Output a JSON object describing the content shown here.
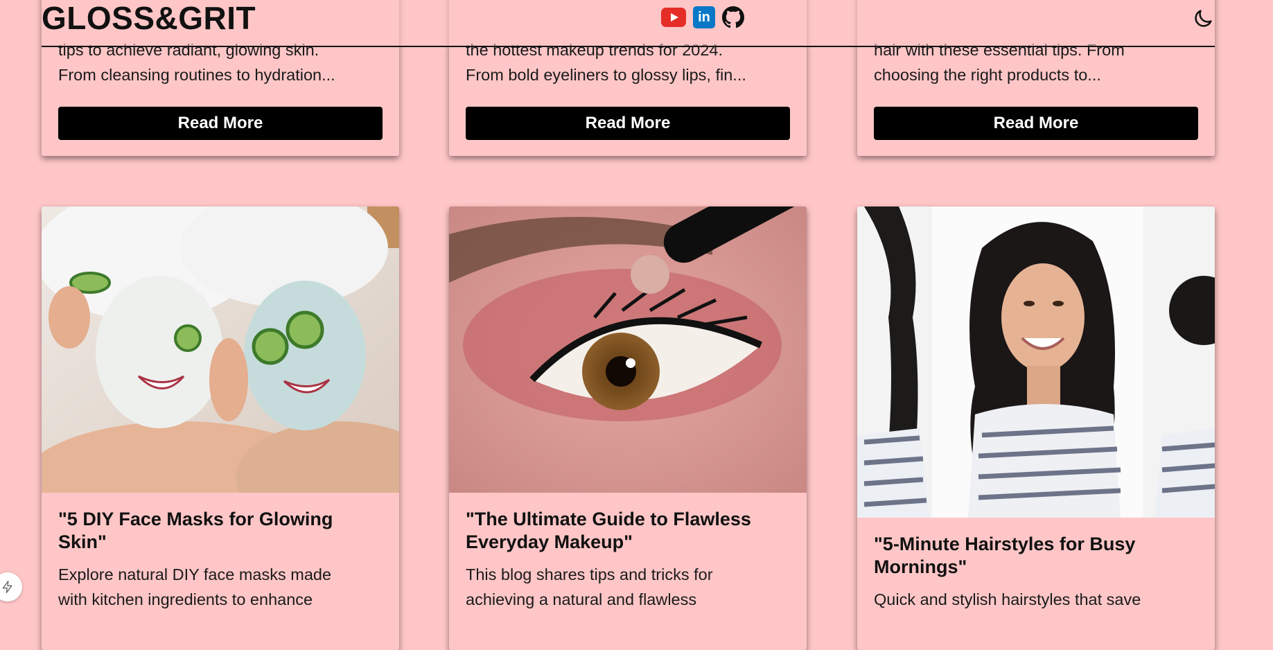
{
  "header": {
    "logo": "GLOSS&GRIT",
    "social": [
      {
        "name": "youtube-icon"
      },
      {
        "name": "linkedin-icon",
        "glyph": "in"
      },
      {
        "name": "github-icon"
      }
    ],
    "theme_toggle": "moon-icon"
  },
  "top_cards": [
    {
      "excerpt": [
        "tips to achieve radiant, glowing skin.",
        "From cleansing routines to hydration..."
      ],
      "button": "Read More"
    },
    {
      "excerpt": [
        "the hottest makeup trends for 2024.",
        "From bold eyeliners to glossy lips, fin..."
      ],
      "button": "Read More"
    },
    {
      "excerpt": [
        "hair with these essential tips. From",
        "choosing the right products to..."
      ],
      "button": "Read More"
    }
  ],
  "bottom_cards": [
    {
      "title": "\"5 DIY Face Masks for Glowing Skin\"",
      "excerpt": [
        "Explore natural DIY face masks made",
        "with kitchen ingredients to enhance"
      ]
    },
    {
      "title": "\"The Ultimate Guide to Flawless Everyday Makeup\"",
      "excerpt": [
        "This blog shares tips and tricks for",
        "achieving a natural and flawless"
      ]
    },
    {
      "title": "\"5-Minute Hairstyles for Busy Mornings\"",
      "excerpt": [
        "Quick and stylish hairstyles that save"
      ]
    }
  ],
  "colors": {
    "background": "#ffc6c7",
    "button": "#000000",
    "youtube": "#e52d27",
    "linkedin": "#0a78c6"
  }
}
